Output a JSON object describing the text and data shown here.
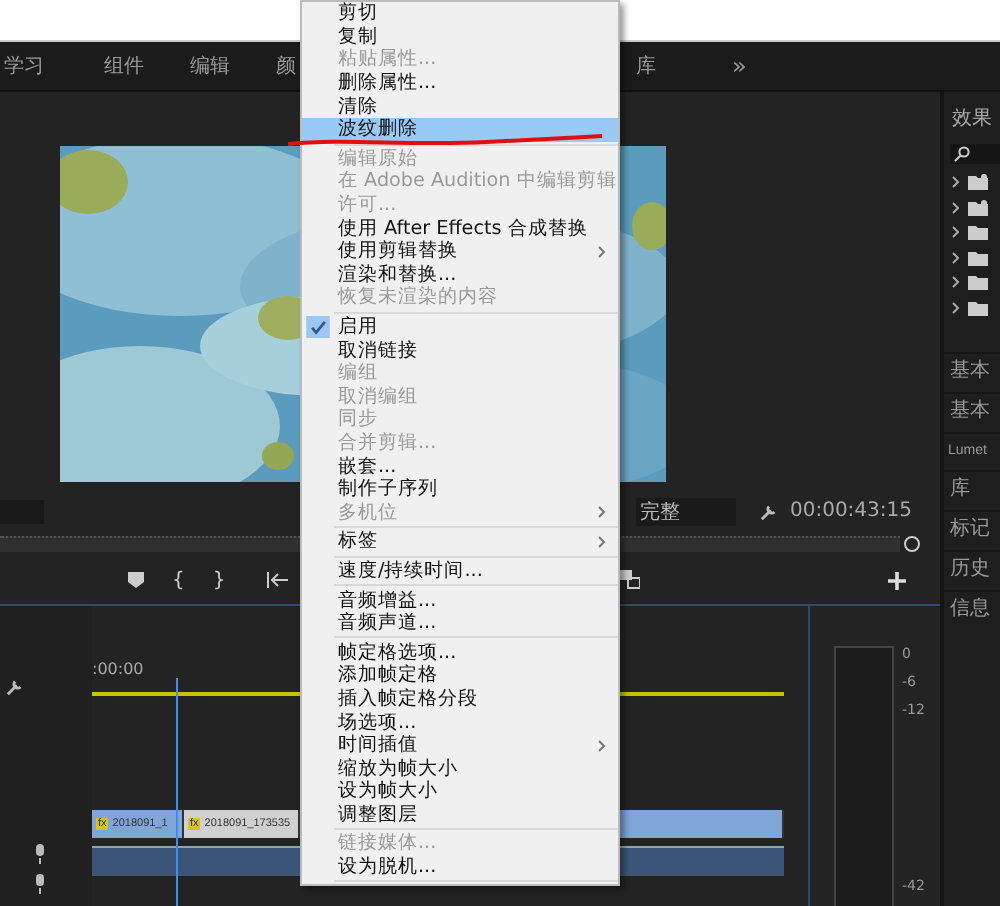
{
  "workspace_tabs": [
    "学习",
    "组件",
    "编辑",
    "颜",
    "库"
  ],
  "overflow_button": "»",
  "program_monitor": {
    "zoom_select": "完整",
    "timecode": "00:00:43:15"
  },
  "transport": {
    "buttons": [
      "{",
      "}"
    ]
  },
  "timeline": {
    "timecode": ":00:00",
    "clips": [
      {
        "badge": "fx",
        "label": "2018091_1",
        "selected": false
      },
      {
        "badge": "fx",
        "label": "2018091_173535",
        "selected": true
      },
      {
        "selected": false
      }
    ]
  },
  "audio_meter": {
    "ticks": [
      "0",
      "-6",
      "-12",
      "-42"
    ]
  },
  "effects_panel": {
    "title": "效果",
    "folders": [
      {
        "kind": "preset"
      },
      {
        "kind": "preset"
      },
      {
        "kind": "folder"
      },
      {
        "kind": "folder"
      },
      {
        "kind": "folder"
      },
      {
        "kind": "folder"
      }
    ]
  },
  "side_panels": [
    "基本",
    "基本",
    "Lumet",
    "库",
    "标记",
    "历史",
    "信息"
  ],
  "context_menu": {
    "items": [
      {
        "kind": "item",
        "label": "剪切",
        "disabled": false,
        "checked": false,
        "submenu": false,
        "selected": false
      },
      {
        "kind": "item",
        "label": "复制",
        "disabled": false,
        "checked": false,
        "submenu": false,
        "selected": false
      },
      {
        "kind": "item",
        "label": "粘贴属性...",
        "disabled": true,
        "checked": false,
        "submenu": false,
        "selected": false
      },
      {
        "kind": "item",
        "label": "删除属性...",
        "disabled": false,
        "checked": false,
        "submenu": false,
        "selected": false
      },
      {
        "kind": "item",
        "label": "清除",
        "disabled": false,
        "checked": false,
        "submenu": false,
        "selected": false
      },
      {
        "kind": "item",
        "label": "波纹删除",
        "disabled": false,
        "checked": false,
        "submenu": false,
        "selected": true
      },
      {
        "kind": "separator"
      },
      {
        "kind": "item",
        "label": "编辑原始",
        "disabled": true,
        "checked": false,
        "submenu": false,
        "selected": false
      },
      {
        "kind": "item",
        "label": "在 Adobe Audition 中编辑剪辑",
        "disabled": true,
        "checked": false,
        "submenu": false,
        "selected": false
      },
      {
        "kind": "item",
        "label": "许可...",
        "disabled": true,
        "checked": false,
        "submenu": false,
        "selected": false
      },
      {
        "kind": "item",
        "label": "使用 After Effects 合成替换",
        "disabled": false,
        "checked": false,
        "submenu": false,
        "selected": false
      },
      {
        "kind": "item",
        "label": "使用剪辑替换",
        "disabled": false,
        "checked": false,
        "submenu": true,
        "selected": false
      },
      {
        "kind": "item",
        "label": "渲染和替换...",
        "disabled": false,
        "checked": false,
        "submenu": false,
        "selected": false
      },
      {
        "kind": "item",
        "label": "恢复未渲染的内容",
        "disabled": true,
        "checked": false,
        "submenu": false,
        "selected": false
      },
      {
        "kind": "separator"
      },
      {
        "kind": "item",
        "label": "启用",
        "disabled": false,
        "checked": true,
        "submenu": false,
        "selected": false
      },
      {
        "kind": "item",
        "label": "取消链接",
        "disabled": false,
        "checked": false,
        "submenu": false,
        "selected": false
      },
      {
        "kind": "item",
        "label": "编组",
        "disabled": true,
        "checked": false,
        "submenu": false,
        "selected": false
      },
      {
        "kind": "item",
        "label": "取消编组",
        "disabled": true,
        "checked": false,
        "submenu": false,
        "selected": false
      },
      {
        "kind": "item",
        "label": "同步",
        "disabled": true,
        "checked": false,
        "submenu": false,
        "selected": false
      },
      {
        "kind": "item",
        "label": "合并剪辑...",
        "disabled": true,
        "checked": false,
        "submenu": false,
        "selected": false
      },
      {
        "kind": "item",
        "label": "嵌套...",
        "disabled": false,
        "checked": false,
        "submenu": false,
        "selected": false
      },
      {
        "kind": "item",
        "label": "制作子序列",
        "disabled": false,
        "checked": false,
        "submenu": false,
        "selected": false
      },
      {
        "kind": "item",
        "label": "多机位",
        "disabled": true,
        "checked": false,
        "submenu": true,
        "selected": false
      },
      {
        "kind": "separator"
      },
      {
        "kind": "item",
        "label": "标签",
        "disabled": false,
        "checked": false,
        "submenu": true,
        "selected": false
      },
      {
        "kind": "separator"
      },
      {
        "kind": "item",
        "label": "速度/持续时间...",
        "disabled": false,
        "checked": false,
        "submenu": false,
        "selected": false
      },
      {
        "kind": "separator"
      },
      {
        "kind": "item",
        "label": "音频增益...",
        "disabled": false,
        "checked": false,
        "submenu": false,
        "selected": false
      },
      {
        "kind": "item",
        "label": "音频声道...",
        "disabled": false,
        "checked": false,
        "submenu": false,
        "selected": false
      },
      {
        "kind": "separator"
      },
      {
        "kind": "item",
        "label": "帧定格选项...",
        "disabled": false,
        "checked": false,
        "submenu": false,
        "selected": false
      },
      {
        "kind": "item",
        "label": "添加帧定格",
        "disabled": false,
        "checked": false,
        "submenu": false,
        "selected": false
      },
      {
        "kind": "item",
        "label": "插入帧定格分段",
        "disabled": false,
        "checked": false,
        "submenu": false,
        "selected": false
      },
      {
        "kind": "item",
        "label": "场选项...",
        "disabled": false,
        "checked": false,
        "submenu": false,
        "selected": false
      },
      {
        "kind": "item",
        "label": "时间插值",
        "disabled": false,
        "checked": false,
        "submenu": true,
        "selected": false
      },
      {
        "kind": "item",
        "label": "缩放为帧大小",
        "disabled": false,
        "checked": false,
        "submenu": false,
        "selected": false
      },
      {
        "kind": "item",
        "label": "设为帧大小",
        "disabled": false,
        "checked": false,
        "submenu": false,
        "selected": false
      },
      {
        "kind": "item",
        "label": "调整图层",
        "disabled": false,
        "checked": false,
        "submenu": false,
        "selected": false
      },
      {
        "kind": "separator"
      },
      {
        "kind": "item",
        "label": "链接媒体...",
        "disabled": true,
        "checked": false,
        "submenu": false,
        "selected": false
      },
      {
        "kind": "item",
        "label": "设为脱机...",
        "disabled": false,
        "checked": false,
        "submenu": false,
        "selected": false
      },
      {
        "kind": "separator"
      }
    ]
  }
}
